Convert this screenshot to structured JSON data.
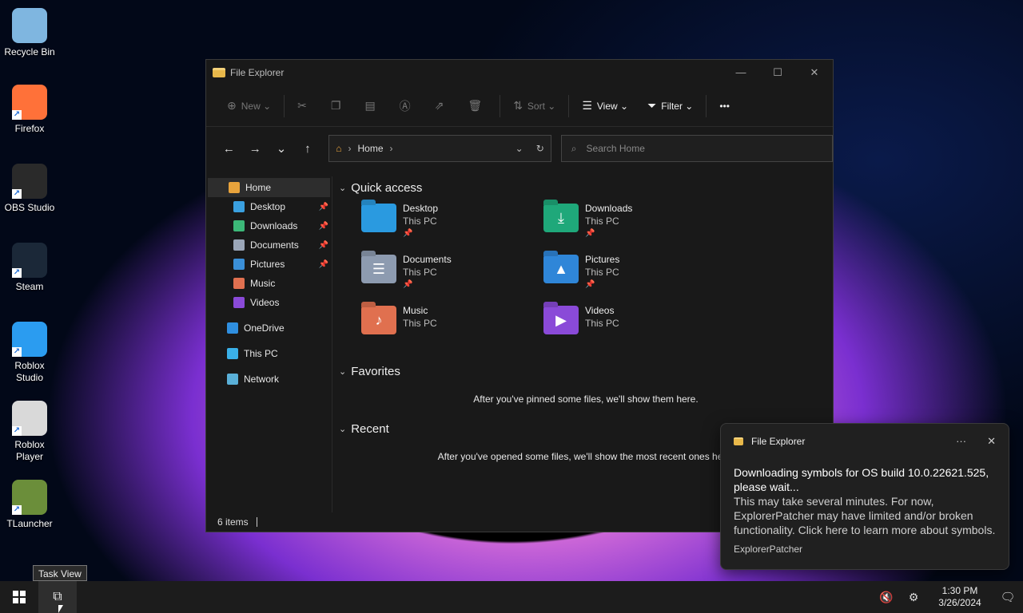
{
  "desktop": {
    "icons": [
      {
        "label": "Recycle Bin",
        "icon": "recycle-bin-icon",
        "color": "#7fb6e0"
      },
      {
        "label": "Firefox",
        "icon": "firefox-icon",
        "color": "#ff7139"
      },
      {
        "label": "OBS Studio",
        "icon": "obs-icon",
        "color": "#2a2a2a"
      },
      {
        "label": "Steam",
        "icon": "steam-icon",
        "color": "#1b2838"
      },
      {
        "label": "Roblox Studio",
        "icon": "roblox-studio-icon",
        "color": "#2b9cf0"
      },
      {
        "label": "Roblox Player",
        "icon": "roblox-player-icon",
        "color": "#d9d9d9"
      },
      {
        "label": "TLauncher",
        "icon": "tlauncher-icon",
        "color": "#6b8e3a"
      }
    ]
  },
  "explorer": {
    "title": "File Explorer",
    "toolbar": {
      "new_label": "New",
      "sort_label": "Sort",
      "view_label": "View",
      "filter_label": "Filter",
      "more_label": "•••"
    },
    "address": {
      "location": "Home"
    },
    "search": {
      "placeholder": "Search Home"
    },
    "sidebar": [
      {
        "label": "Home",
        "icon": "home-icon",
        "color": "#e8a33c",
        "indent": false,
        "pinned": false,
        "selected": true
      },
      {
        "label": "Desktop",
        "icon": "desktop-icon",
        "color": "#3aa0e0",
        "indent": true,
        "pinned": true
      },
      {
        "label": "Downloads",
        "icon": "download-icon",
        "color": "#3cb878",
        "indent": true,
        "pinned": true
      },
      {
        "label": "Documents",
        "icon": "documents-icon",
        "color": "#9aa6b8",
        "indent": true,
        "pinned": true
      },
      {
        "label": "Pictures",
        "icon": "pictures-icon",
        "color": "#3a8fd8",
        "indent": true,
        "pinned": true
      },
      {
        "label": "Music",
        "icon": "music-icon",
        "color": "#e07050",
        "indent": true,
        "pinned": false
      },
      {
        "label": "Videos",
        "icon": "videos-icon",
        "color": "#8a4ad8",
        "indent": true,
        "pinned": false
      },
      {
        "label": "OneDrive",
        "icon": "onedrive-icon",
        "color": "#2f8fe0",
        "indent": false,
        "pinned": false
      },
      {
        "label": "This PC",
        "icon": "this-pc-icon",
        "color": "#3ab0e8",
        "indent": false,
        "pinned": false
      },
      {
        "label": "Network",
        "icon": "network-icon",
        "color": "#5ab0d8",
        "indent": false,
        "pinned": false
      }
    ],
    "sections": {
      "quick_access": "Quick access",
      "favorites": "Favorites",
      "recent": "Recent"
    },
    "quick_access": [
      {
        "name": "Desktop",
        "sub": "This PC",
        "pinned": true,
        "icon": "desktop-folder-icon",
        "color": "#2a9ae0",
        "glyph": ""
      },
      {
        "name": "Downloads",
        "sub": "This PC",
        "pinned": true,
        "icon": "downloads-folder-icon",
        "color": "#1fa87a",
        "glyph": "⤓"
      },
      {
        "name": "Documents",
        "sub": "This PC",
        "pinned": true,
        "icon": "documents-folder-icon",
        "color": "#8d9bb0",
        "glyph": "☰"
      },
      {
        "name": "Pictures",
        "sub": "This PC",
        "pinned": true,
        "icon": "pictures-folder-icon",
        "color": "#2f86d8",
        "glyph": "▲"
      },
      {
        "name": "Music",
        "sub": "This PC",
        "pinned": false,
        "icon": "music-folder-icon",
        "color": "#e0704f",
        "glyph": "♪"
      },
      {
        "name": "Videos",
        "sub": "This PC",
        "pinned": false,
        "icon": "videos-folder-icon",
        "color": "#8a4ad8",
        "glyph": "▶"
      }
    ],
    "favorites_empty": "After you've pinned some files, we'll show them here.",
    "recent_empty": "After you've opened some files, we'll show the most recent ones here.",
    "status": "6 items"
  },
  "toast": {
    "app": "File Explorer",
    "title": "Downloading symbols for OS build 10.0.22621.525, please wait...",
    "body": "This may take several minutes. For now, ExplorerPatcher may have limited and/or broken functionality. Click here to learn more about symbols.",
    "source": "ExplorerPatcher",
    "more": "···",
    "close": "✕"
  },
  "tooltip": "Task View",
  "taskbar": {
    "time": "1:30 PM",
    "date": "3/26/2024"
  }
}
